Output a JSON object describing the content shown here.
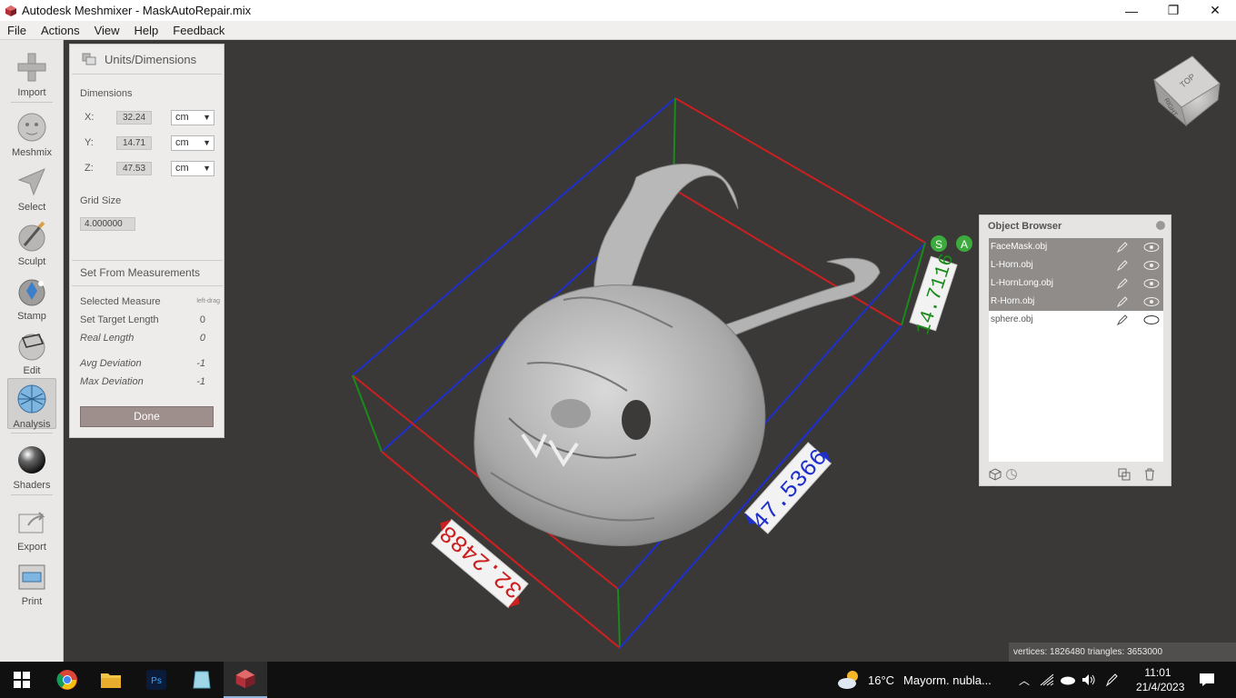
{
  "window": {
    "title": "Autodesk Meshmixer - MaskAutoRepair.mix",
    "minimize": "—",
    "maximize": "❐",
    "close": "✕"
  },
  "menu": [
    "File",
    "Actions",
    "View",
    "Help",
    "Feedback"
  ],
  "tools": [
    {
      "label": "Import",
      "icon": "plus-icon"
    },
    {
      "label": "Meshmix",
      "icon": "meshmix-head-icon"
    },
    {
      "label": "Select",
      "icon": "cursor-icon"
    },
    {
      "label": "Sculpt",
      "icon": "brush-sphere-icon"
    },
    {
      "label": "Stamp",
      "icon": "stamp-sphere-icon"
    },
    {
      "label": "Edit",
      "icon": "edit-sphere-icon"
    },
    {
      "label": "Analysis",
      "icon": "analysis-sphere-icon"
    },
    {
      "label": "Shaders",
      "icon": "shader-sphere-icon"
    },
    {
      "label": "Export",
      "icon": "export-icon"
    },
    {
      "label": "Print",
      "icon": "printer-icon"
    }
  ],
  "units_panel": {
    "title": "Units/Dimensions",
    "dimensions_label": "Dimensions",
    "x_label": "X:",
    "x_value": "32.24",
    "x_unit": "cm",
    "y_label": "Y:",
    "y_value": "14.71",
    "y_unit": "cm",
    "z_label": "Z:",
    "z_value": "47.53",
    "z_unit": "cm",
    "grid_label": "Grid Size",
    "grid_value": "4.000000",
    "measurements_title": "Set From Measurements",
    "selected_measure": "Selected Measure",
    "selected_hint": "left-drag",
    "target_length": "Set Target Length",
    "target_value": "0",
    "real_length": "Real Length",
    "real_value": "0",
    "avg_dev": "Avg Deviation",
    "avg_value": "-1",
    "max_dev": "Max Deviation",
    "max_value": "-1",
    "done": "Done"
  },
  "object_browser": {
    "title": "Object Browser",
    "objects": [
      {
        "name": "FaceMask.obj",
        "selected": true
      },
      {
        "name": "L-Horn.obj",
        "selected": true
      },
      {
        "name": "L-HornLong.obj",
        "selected": true
      },
      {
        "name": "R-Horn.obj",
        "selected": true
      },
      {
        "name": "sphere.obj",
        "selected": false
      }
    ]
  },
  "viewport": {
    "dim_x": "32.2488",
    "dim_y": "14.7116",
    "dim_z": "47.5366",
    "badge_s": "S",
    "badge_a": "A",
    "cube_top": "TOP",
    "cube_right": "RIGHT"
  },
  "stats": "vertices: 1826480 triangles: 3653000",
  "taskbar": {
    "weather_temp": "16°C",
    "weather_text": "Mayorm. nubla...",
    "time": "11:01",
    "date": "21/4/2023"
  },
  "colors": {
    "x_axis": "#cc1f1f",
    "y_axis": "#1a8a1a",
    "z_axis": "#1f2fcc",
    "selected_row": "#8f8c89",
    "done_button": "#9e8e8c"
  }
}
